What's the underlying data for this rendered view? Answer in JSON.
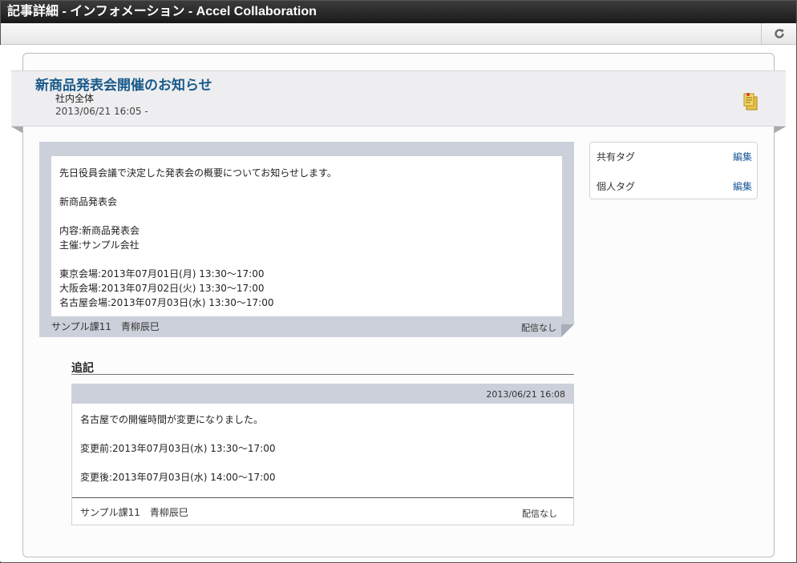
{
  "window": {
    "title": "記事詳細 - インフォメーション - Accel Collaboration"
  },
  "toolbar": {
    "reload_icon": "reload-icon"
  },
  "article": {
    "title": "新商品発表会開催のお知らせ",
    "category": "社内全体",
    "date": "2013/06/21 16:05 -",
    "memo_icon": "memo-icon",
    "body_lines": [
      "先日役員会議で決定した発表会の概要についてお知らせします。",
      "",
      "新商品発表会",
      "",
      "内容:新商品発表会",
      "主催:サンプル会社",
      "",
      "東京会場:2013年07月01日(月) 13:30～17:00",
      "大阪会場:2013年07月02日(火) 13:30～17:00",
      "名古屋会場:2013年07月03日(水) 13:30～17:00"
    ],
    "author": "サンプル課11　青柳辰巳",
    "delivery": "配信なし"
  },
  "tags": {
    "shared_label": "共有タグ",
    "shared_edit": "編集",
    "personal_label": "個人タグ",
    "personal_edit": "編集"
  },
  "addendum": {
    "heading": "追記",
    "date": "2013/06/21 16:08",
    "body_lines": [
      "名古屋での開催時間が変更になりました。",
      "",
      "変更前:2013年07月03日(水) 13:30～17:00",
      "",
      "変更後:2013年07月03日(水) 14:00～17:00"
    ],
    "author": "サンプル課11　青柳辰巳",
    "delivery": "配信なし"
  }
}
